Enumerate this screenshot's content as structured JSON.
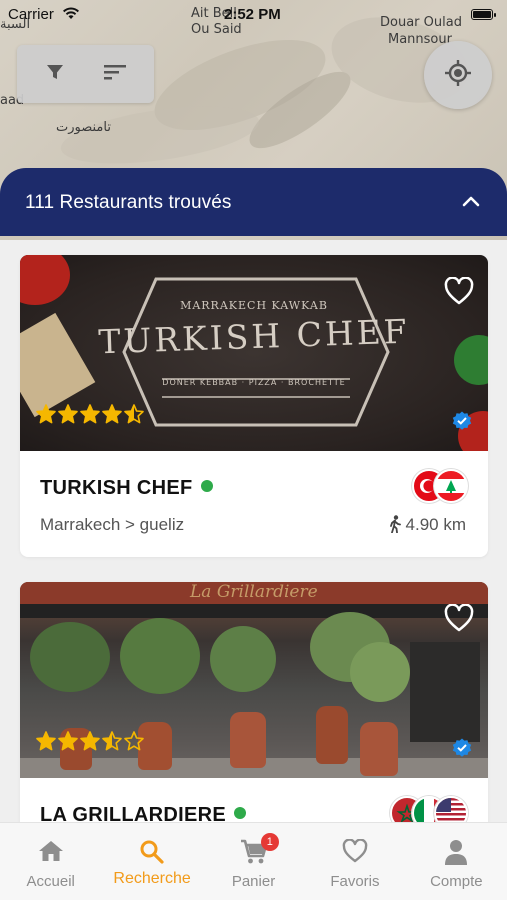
{
  "status_bar": {
    "carrier": "Carrier",
    "time": "2:52 PM"
  },
  "map": {
    "labels": [
      "السبة",
      "Ait Bell",
      "Ou Said",
      "Douar Oulad",
      "Mannsour",
      "aad",
      "تامنصورت"
    ]
  },
  "results": {
    "title": "111 Restaurants trouvés"
  },
  "restaurants": [
    {
      "name": "TURKISH CHEF",
      "location": "Marrakech > gueliz",
      "distance": "4.90 km",
      "rating": 4.5,
      "sign_top": "MARRAKECH KAWKAB",
      "sign_main": "TURKISH CHEF",
      "sign_bottom": "DONER KEBBAB · PIZZA · BROCHETTE",
      "flags": [
        "turkey-flag",
        "lebanon-flag"
      ]
    },
    {
      "name": "LA GRILLARDIERE",
      "rating": 3.5,
      "sign_main": "La Grillardiere",
      "flags": [
        "morocco-flag",
        "italy-flag",
        "usa-flag"
      ]
    }
  ],
  "tabs": [
    {
      "label": "Accueil",
      "icon": "home-icon"
    },
    {
      "label": "Recherche",
      "icon": "search-icon"
    },
    {
      "label": "Panier",
      "icon": "cart-icon",
      "badge": "1"
    },
    {
      "label": "Favoris",
      "icon": "heart-icon"
    },
    {
      "label": "Compte",
      "icon": "person-icon"
    }
  ],
  "colors": {
    "header": "#1d2b6b",
    "accent": "#f29b1a",
    "star": "#f5b700",
    "online": "#2eaa4a",
    "verified": "#1e88e5",
    "badge": "#e53935"
  }
}
